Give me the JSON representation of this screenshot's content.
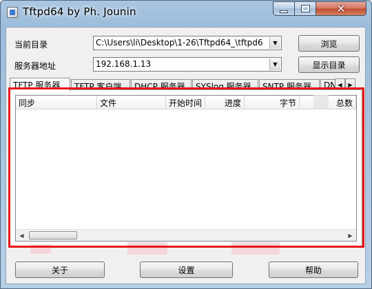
{
  "window": {
    "title": "Tftpd64 by Ph. Jounin",
    "icon": "app-icon",
    "controls": [
      "minimize-icon",
      "maximize-icon",
      "close-icon"
    ],
    "close_glyph": "✕"
  },
  "form": {
    "current_dir_label": "当前目录",
    "current_dir_value": "C:\\Users\\li\\Desktop\\1-26\\Tftpd64_\\tftpd6",
    "browse_button": "浏览",
    "server_addr_label": "服务器地址",
    "server_addr_value": "192.168.1.13",
    "show_dir_button": "显示目录",
    "dropdown_glyph": "▼"
  },
  "tabs": [
    {
      "label": "TFTP 服务器",
      "active": true
    },
    {
      "label": "TFTP 客户端",
      "active": false
    },
    {
      "label": "DHCP 服务器",
      "active": false
    },
    {
      "label": "SYSlog 服务器",
      "active": false
    },
    {
      "label": "SNTP 服务器",
      "active": false
    },
    {
      "label": "DN",
      "active": false
    }
  ],
  "tab_scroll": {
    "left": "◀",
    "right": "▶"
  },
  "table": {
    "columns": [
      "同步",
      "文件",
      "开始时间",
      "进度",
      "字节",
      "总数"
    ]
  },
  "scrollbar": {
    "left": "◀",
    "right": "▶"
  },
  "footer": {
    "about_button": "关于",
    "settings_button": "设置",
    "help_button": "帮助"
  },
  "colors": {
    "highlight_border": "#e8141a",
    "title_bar": "#a9c6e2",
    "close_button": "#c04b33"
  }
}
